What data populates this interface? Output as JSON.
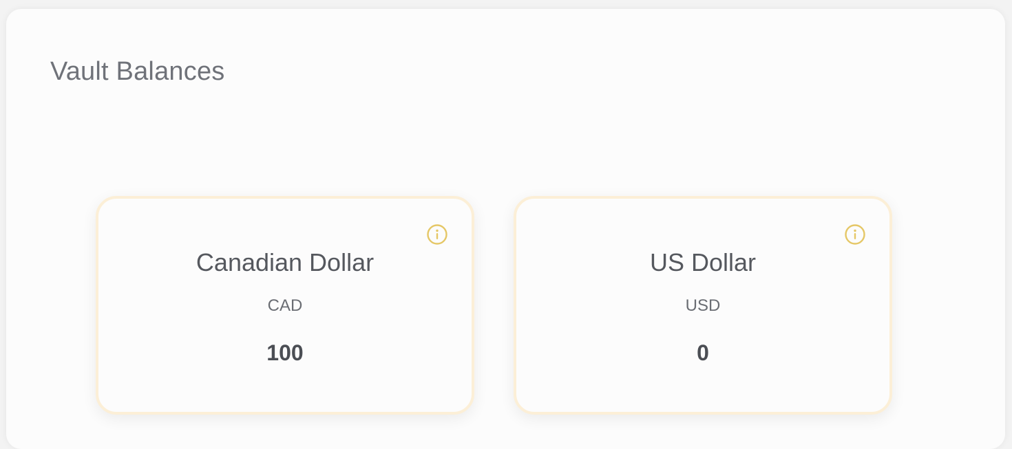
{
  "title": "Vault Balances",
  "accent_color": "#e5c766",
  "card_border_color": "#fcefd7",
  "balances": [
    {
      "name": "Canadian Dollar",
      "code": "CAD",
      "amount": "100",
      "icon": "info-icon"
    },
    {
      "name": "US Dollar",
      "code": "USD",
      "amount": "0",
      "icon": "info-icon"
    }
  ]
}
